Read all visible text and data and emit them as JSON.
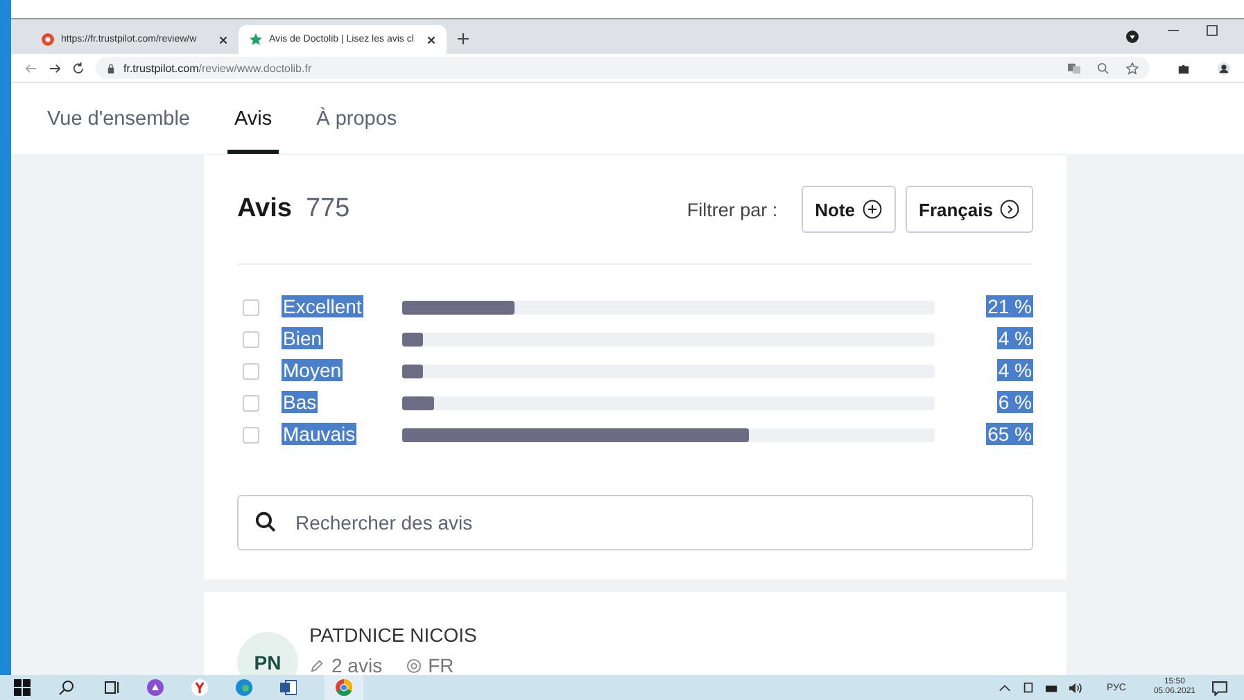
{
  "browser": {
    "tabs": [
      {
        "title": "https://fr.trustpilot.com/review/w",
        "selected": false
      },
      {
        "title": "Avis de Doctolib | Lisez les avis cl",
        "selected": true
      }
    ],
    "url_host": "fr.trustpilot.com",
    "url_path": "/review/www.doctolib.fr"
  },
  "nav": [
    {
      "label": "Vue d'ensemble",
      "selected": false
    },
    {
      "label": "Avis",
      "selected": true
    },
    {
      "label": "À propos",
      "selected": false
    }
  ],
  "reviews": {
    "title": "Avis",
    "count": "775",
    "filter_label": "Filtrer par :",
    "filters": [
      {
        "label": "Note",
        "kind": "plus"
      },
      {
        "label": "Français",
        "kind": "chevron"
      }
    ],
    "text_selected": true,
    "ratings": [
      {
        "label": "Excellent",
        "checked": false,
        "level": 0.21,
        "percent": "21 %"
      },
      {
        "label": "Bien",
        "checked": false,
        "level": 0.04,
        "percent": "4 %"
      },
      {
        "label": "Moyen",
        "checked": false,
        "level": 0.04,
        "percent": "4 %"
      },
      {
        "label": "Bas",
        "checked": false,
        "level": 0.06,
        "percent": "6 %"
      },
      {
        "label": "Mauvais",
        "checked": false,
        "level": 0.65,
        "percent": "65 %"
      }
    ],
    "search": {
      "placeholder": "Rechercher des avis"
    }
  },
  "review": {
    "initials": "PN",
    "name": "PATDNICE NICOIS",
    "reviews_count": "2 avis",
    "country": "FR"
  },
  "taskbar": {
    "language": "РУС",
    "time": "15:50",
    "date": "05.06.2021"
  }
}
